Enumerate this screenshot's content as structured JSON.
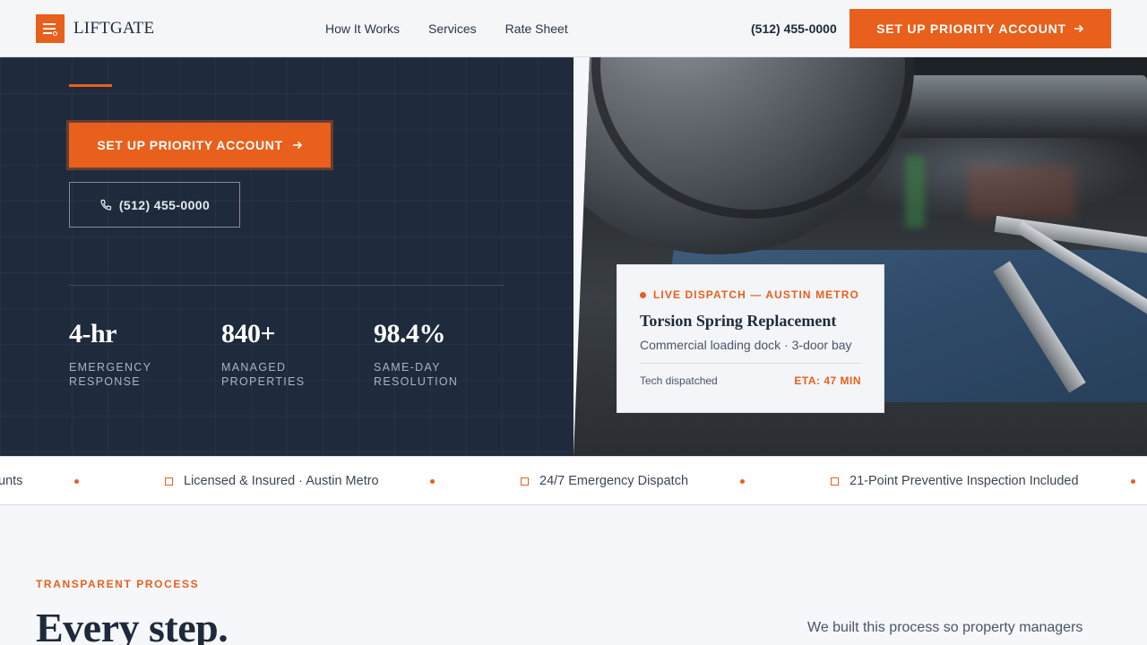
{
  "header": {
    "brand": "LIFTGATE",
    "logo_icon": "garage-door-icon",
    "nav": [
      "How It Works",
      "Services",
      "Rate Sheet"
    ],
    "phone": "(512) 455-0000",
    "cta_label": "SET UP PRIORITY ACCOUNT",
    "cta_icon": "arrow-right-icon"
  },
  "hero": {
    "primary_button": "SET UP PRIORITY ACCOUNT",
    "phone_button": "(512) 455-0000",
    "stats": [
      {
        "value": "4-hr",
        "label": "EMERGENCY RESPONSE"
      },
      {
        "value": "840+",
        "label": "MANAGED PROPERTIES"
      },
      {
        "value": "98.4%",
        "label": "SAME-DAY RESOLUTION"
      }
    ]
  },
  "dispatch_card": {
    "status": "LIVE DISPATCH — AUSTIN METRO",
    "title": "Torsion Spring Replacement",
    "subtitle": "Commercial loading dock · 3-door bay",
    "tech_status": "Tech dispatched",
    "eta": "ETA: 47 MIN"
  },
  "ticker": {
    "items": [
      "unts",
      "Licensed & Insured · Austin Metro",
      "24/7 Emergency Dispatch",
      "21-Point Preventive Inspection Included"
    ]
  },
  "process": {
    "eyebrow": "TRANSPARENT PROCESS",
    "heading": "Every step.",
    "intro": "We built this process so property managers"
  },
  "colors": {
    "accent": "#e8601c",
    "navy": "#1f2b3c",
    "header_bg": "#f4f6f8"
  }
}
